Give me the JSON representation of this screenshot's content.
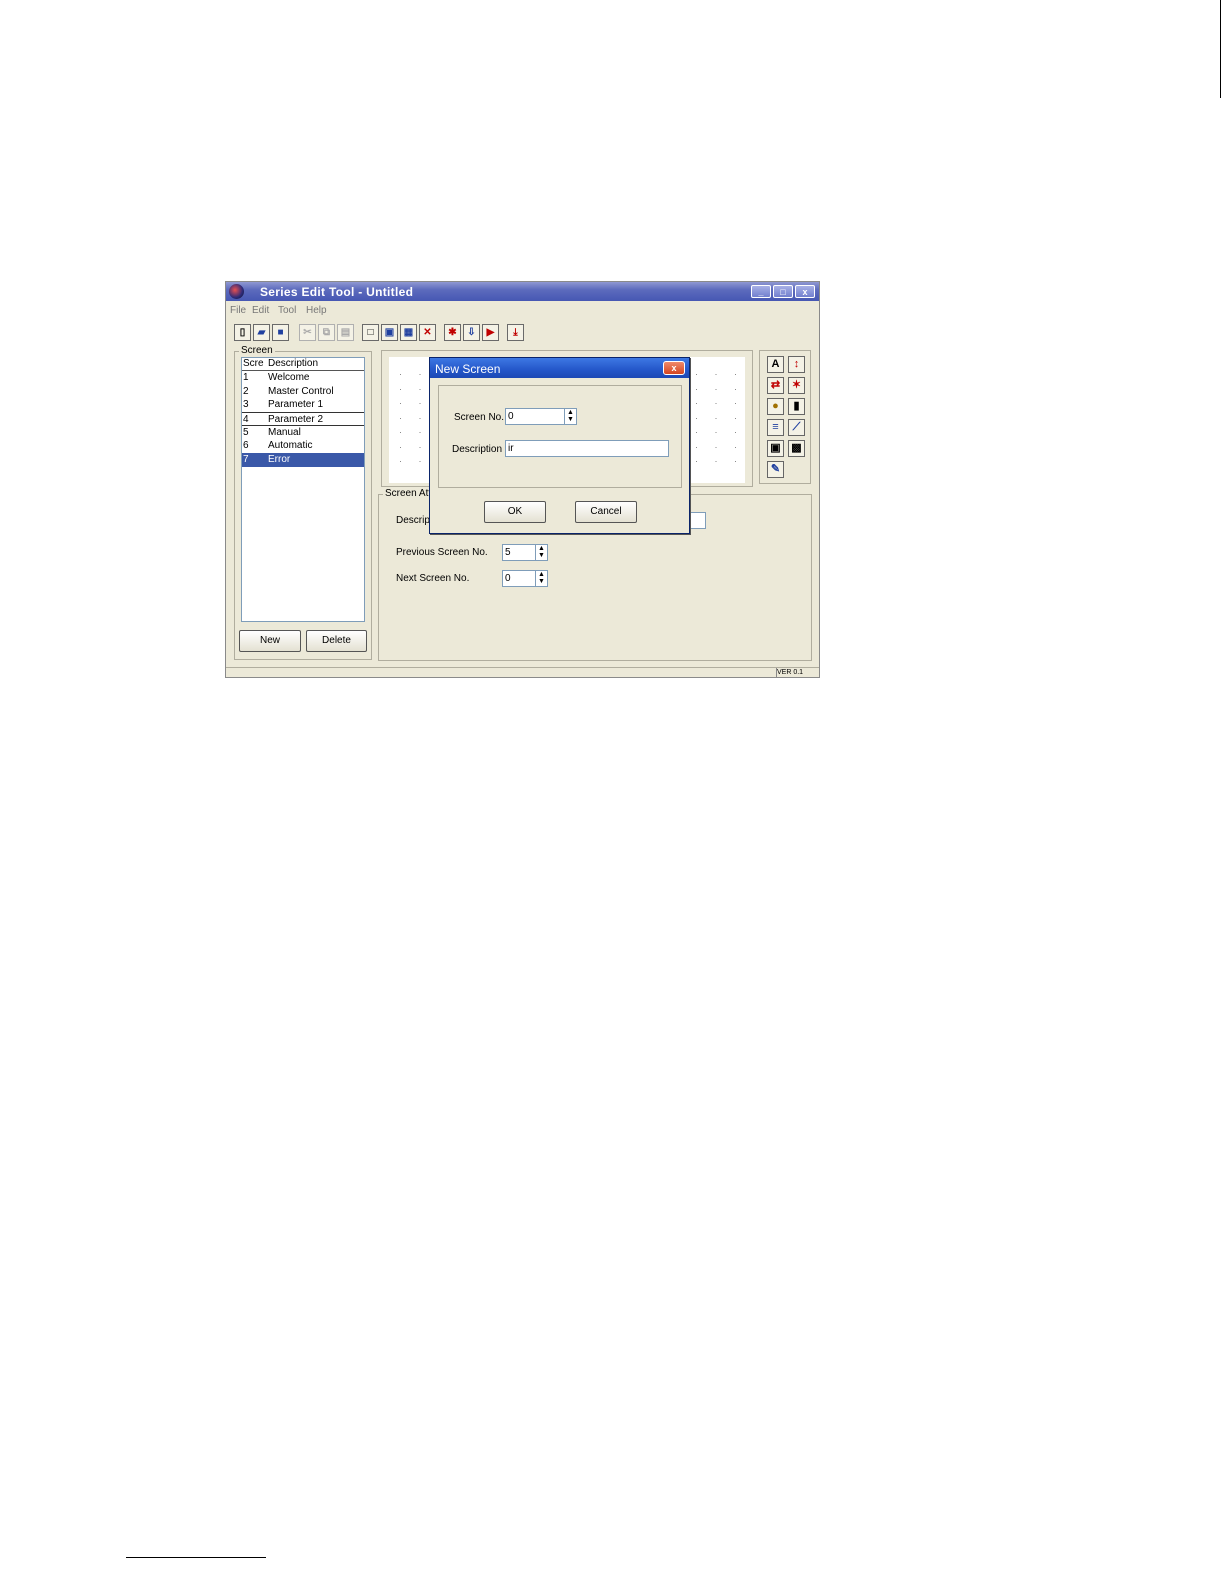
{
  "window": {
    "title": "Series Edit Tool - Untitled",
    "controls": {
      "minimize": "_",
      "maximize": "□",
      "close": "x"
    }
  },
  "menu": [
    "File",
    "Edit",
    "Tool",
    "Help"
  ],
  "toolbar": {
    "icons": [
      "new-icon",
      "open-icon",
      "save-icon",
      "cut-icon",
      "copy-icon",
      "paste-icon",
      "screen-icon",
      "add-screen-icon",
      "copy-screen-icon",
      "delete-screen-icon",
      "settings-icon",
      "import-icon",
      "export-icon",
      "download-icon"
    ]
  },
  "screen_panel": {
    "group_title": "Screen",
    "columns": [
      "Scre",
      "Description"
    ],
    "rows": [
      {
        "no": "1",
        "desc": "Welcome"
      },
      {
        "no": "2",
        "desc": "Master Control"
      },
      {
        "no": "3",
        "desc": "Parameter 1"
      },
      {
        "no": "4",
        "desc": "Parameter 2"
      },
      {
        "no": "5",
        "desc": "Manual"
      },
      {
        "no": "6",
        "desc": "Automatic"
      },
      {
        "no": "7",
        "desc": "Error"
      }
    ],
    "new_label": "New",
    "delete_label": "Delete"
  },
  "palette": {
    "icons": [
      "text-icon",
      "numeric-icon",
      "value-icon",
      "alarm-icon",
      "lamp-icon",
      "bar-icon",
      "list-icon",
      "trend-icon",
      "button-icon",
      "bitmap-icon",
      "graphic-icon"
    ]
  },
  "attributes": {
    "group_title": "Screen Att",
    "description_label": "Descript",
    "previous_label": "Previous Screen No.",
    "previous_value": "5",
    "next_label": "Next Screen No.",
    "next_value": "0"
  },
  "status": {
    "pane": "VER 0.1"
  },
  "dialog": {
    "title": "New Screen",
    "close": "x",
    "screen_no_label": "Screen No.",
    "screen_no_value": "0",
    "description_label": "Description",
    "description_value": "ir",
    "ok_label": "OK",
    "cancel_label": "Cancel"
  },
  "colors": {
    "titlebar": "#4657b3",
    "dialog_titlebar": "#2456c9",
    "selection": "#3a58a8",
    "face": "#ece9d8"
  }
}
